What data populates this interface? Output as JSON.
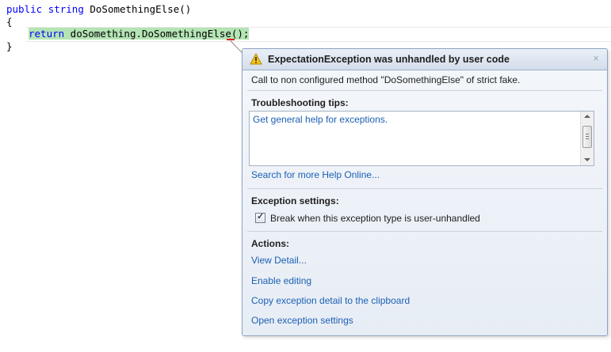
{
  "code": {
    "line1_kw1": "public",
    "line1_kw2": "string",
    "line1_rest": " DoSomethingElse()",
    "line2": "{",
    "line3_kw": "return",
    "line3_rest": " doSomething.DoSomethingElse();",
    "line4": "}"
  },
  "popup": {
    "title": "ExpectationException was unhandled by user code",
    "close": "×",
    "message": "Call to non configured method \"DoSomethingElse\" of strict fake.",
    "troubleshooting_title": "Troubleshooting tips:",
    "tips": [
      "Get general help for exceptions."
    ],
    "search_link": "Search for more Help Online...",
    "exception_settings_title": "Exception settings:",
    "checkbox_label": "Break when this exception type is user-unhandled",
    "checkbox_checked": true,
    "actions_title": "Actions:",
    "actions": [
      "View Detail...",
      "Enable editing",
      "Copy exception detail to the clipboard",
      "Open exception settings"
    ]
  },
  "colors": {
    "keyword": "#0000ff",
    "link": "#1c5fb3",
    "highlight": "#b4e4b4"
  }
}
